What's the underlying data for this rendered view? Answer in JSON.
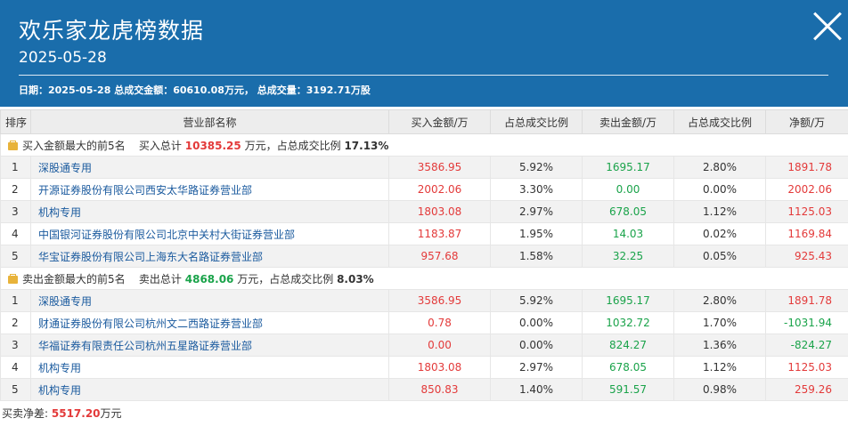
{
  "header": {
    "title": "欢乐家龙虎榜数据",
    "date": "2025-05-28",
    "summary": "日期：2025-05-28 总成交金额：60610.08万元， 总成交量：3192.71万股"
  },
  "table": {
    "columns": [
      "排序",
      "营业部名称",
      "买入金额/万",
      "占总成交比例",
      "卖出金额/万",
      "占总成交比例",
      "净额/万"
    ],
    "buy_section": {
      "label": "买入金额最大的前5名",
      "total_prefix": "买入总计",
      "total_value": "10385.25",
      "total_suffix": "万元，占总成交比例",
      "pct": "17.13%"
    },
    "buy_rows": [
      {
        "rank": "1",
        "name": "深股通专用",
        "buy": "3586.95",
        "buy_pct": "5.92%",
        "sell": "1695.17",
        "sell_pct": "2.80%",
        "net": "1891.78"
      },
      {
        "rank": "2",
        "name": "开源证券股份有限公司西安太华路证券营业部",
        "buy": "2002.06",
        "buy_pct": "3.30%",
        "sell": "0.00",
        "sell_pct": "0.00%",
        "net": "2002.06"
      },
      {
        "rank": "3",
        "name": "机构专用",
        "buy": "1803.08",
        "buy_pct": "2.97%",
        "sell": "678.05",
        "sell_pct": "1.12%",
        "net": "1125.03"
      },
      {
        "rank": "4",
        "name": "中国银河证券股份有限公司北京中关村大街证券营业部",
        "buy": "1183.87",
        "buy_pct": "1.95%",
        "sell": "14.03",
        "sell_pct": "0.02%",
        "net": "1169.84"
      },
      {
        "rank": "5",
        "name": "华宝证券股份有限公司上海东大名路证券营业部",
        "buy": "957.68",
        "buy_pct": "1.58%",
        "sell": "32.25",
        "sell_pct": "0.05%",
        "net": "925.43"
      }
    ],
    "sell_section": {
      "label": "卖出金额最大的前5名",
      "total_prefix": "卖出总计",
      "total_value": "4868.06",
      "total_suffix": "万元，占总成交比例",
      "pct": "8.03%"
    },
    "sell_rows": [
      {
        "rank": "1",
        "name": "深股通专用",
        "buy": "3586.95",
        "buy_pct": "5.92%",
        "sell": "1695.17",
        "sell_pct": "2.80%",
        "net": "1891.78"
      },
      {
        "rank": "2",
        "name": "财通证券股份有限公司杭州文二西路证券营业部",
        "buy": "0.78",
        "buy_pct": "0.00%",
        "sell": "1032.72",
        "sell_pct": "1.70%",
        "net": "-1031.94"
      },
      {
        "rank": "3",
        "name": "华福证券有限责任公司杭州五星路证券营业部",
        "buy": "0.00",
        "buy_pct": "0.00%",
        "sell": "824.27",
        "sell_pct": "1.36%",
        "net": "-824.27"
      },
      {
        "rank": "4",
        "name": "机构专用",
        "buy": "1803.08",
        "buy_pct": "2.97%",
        "sell": "678.05",
        "sell_pct": "1.12%",
        "net": "1125.03"
      },
      {
        "rank": "5",
        "name": "机构专用",
        "buy": "850.83",
        "buy_pct": "1.40%",
        "sell": "591.57",
        "sell_pct": "0.98%",
        "net": "259.26"
      }
    ]
  },
  "footer": {
    "label": "买卖净差:",
    "value": "5517.20",
    "unit": "万元"
  },
  "colors": {
    "header_bg": "#1a6dab",
    "buy_red": "#e33a3a",
    "sell_green": "#1aa34a",
    "link_blue": "#1a5a9e"
  },
  "icons": {
    "close": "close-icon",
    "section": "briefcase-icon"
  }
}
